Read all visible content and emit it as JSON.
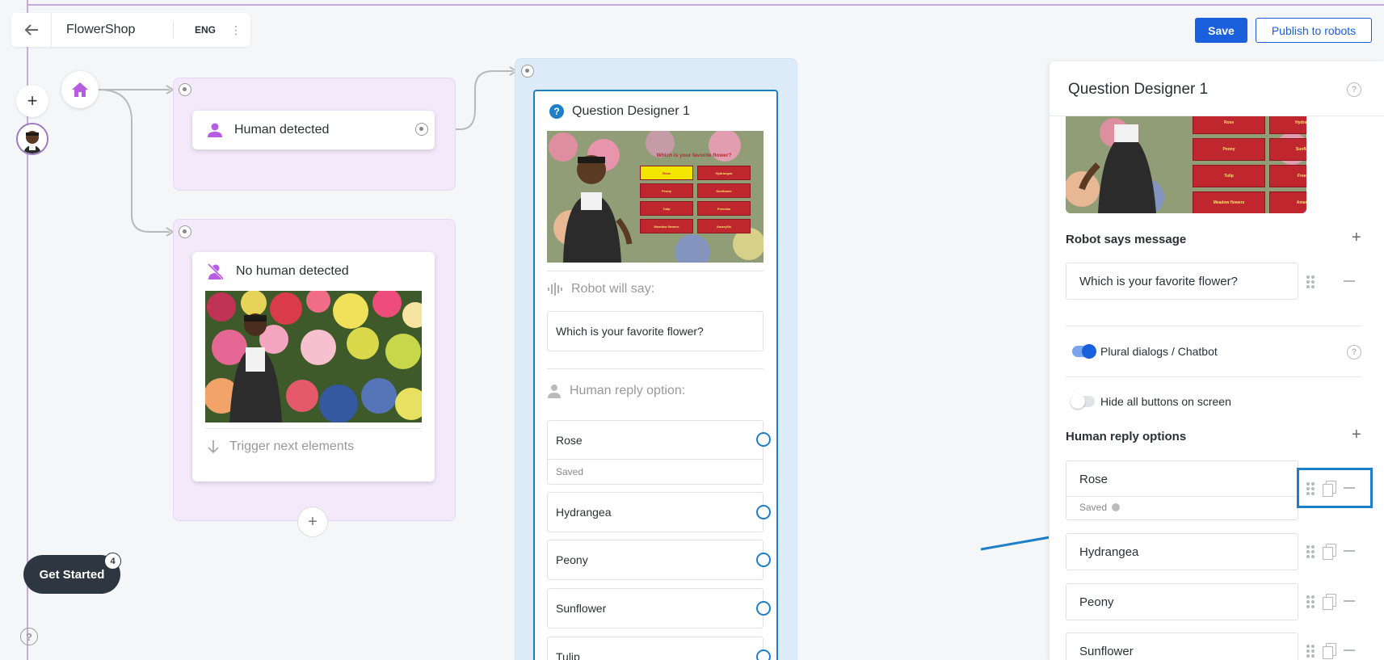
{
  "header": {
    "app_title": "FlowerShop",
    "language": "ENG",
    "save_label": "Save",
    "publish_label": "Publish to robots"
  },
  "flow": {
    "human_detected": "Human detected",
    "no_human_detected": "No human detected",
    "trigger_next": "Trigger next elements"
  },
  "question_card": {
    "title": "Question Designer 1",
    "robot_will_say": "Robot will say:",
    "message": "Which is your favorite flower?",
    "human_reply_option": "Human reply option:",
    "saved": "Saved",
    "options": [
      "Rose",
      "Hydrangea",
      "Peony",
      "Sunflower",
      "Tulip"
    ]
  },
  "thumbnail": {
    "question": "Which is your favorite flower?",
    "buttons": [
      "Rose",
      "Hydrangea",
      "Peony",
      "Sunflower",
      "Tulip",
      "Freesias",
      "Meadow flowers",
      "Amaryllis"
    ]
  },
  "panel": {
    "title": "Question Designer 1",
    "robot_says_message": "Robot says message",
    "message_value": "Which is your favorite flower?",
    "plural_dialogs": "Plural dialogs / Chatbot",
    "plural_dialogs_on": true,
    "hide_buttons": "Hide all buttons on screen",
    "hide_buttons_on": false,
    "human_reply_options": "Human reply options",
    "saved": "Saved",
    "options": [
      "Rose",
      "Hydrangea",
      "Peony",
      "Sunflower"
    ]
  },
  "footer": {
    "get_started": "Get Started",
    "badge_count": "4"
  },
  "colors": {
    "primary": "#1a5fdb",
    "accent_blue": "#1d7fc7",
    "purple": "#b65de4",
    "flow_lavender": "#f3e9fb",
    "flow_blue": "#dcebf7",
    "thumb_button": "#c0262e",
    "thumb_highlight": "#f2e600"
  },
  "icons": {
    "back": "arrow-left-icon",
    "home": "home-icon",
    "person": "person-icon",
    "person_off": "person-off-icon",
    "question": "question-icon",
    "waveform": "waveform-icon",
    "arrow_down": "arrow-down-icon",
    "help": "help-icon",
    "drag": "drag-handle-icon",
    "copy": "copy-icon",
    "remove": "minus-icon"
  }
}
